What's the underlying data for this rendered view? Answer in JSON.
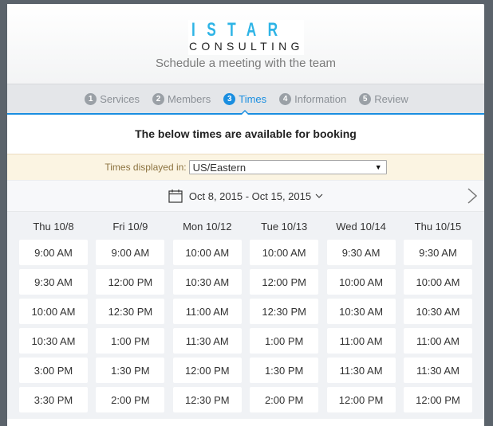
{
  "brand": {
    "logo_top": "ISTAR",
    "logo_bottom": "CONSULTING",
    "tagline": "Schedule a meeting with the team",
    "accent_color": "#2eb4e6"
  },
  "steps": [
    {
      "num": "1",
      "label": "Services",
      "active": false
    },
    {
      "num": "2",
      "label": "Members",
      "active": false
    },
    {
      "num": "3",
      "label": "Times",
      "active": true
    },
    {
      "num": "4",
      "label": "Information",
      "active": false
    },
    {
      "num": "5",
      "label": "Review",
      "active": false
    }
  ],
  "notice": "The below times are available for booking",
  "timezone": {
    "label": "Times displayed in:",
    "selected": "US/Eastern"
  },
  "date_range": {
    "label": "Oct 8, 2015 - Oct 15, 2015",
    "calendar_icon": "calendar-icon",
    "dropdown_icon": "chevron-down-icon",
    "next_icon": "chevron-right-icon"
  },
  "days": [
    {
      "label": "Thu 10/8",
      "slots": [
        "9:00 AM",
        "9:30 AM",
        "10:00 AM",
        "10:30 AM",
        "3:00 PM",
        "3:30 PM"
      ]
    },
    {
      "label": "Fri 10/9",
      "slots": [
        "9:00 AM",
        "12:00 PM",
        "12:30 PM",
        "1:00 PM",
        "1:30 PM",
        "2:00 PM"
      ]
    },
    {
      "label": "Mon 10/12",
      "slots": [
        "10:00 AM",
        "10:30 AM",
        "11:00 AM",
        "11:30 AM",
        "12:00 PM",
        "12:30 PM"
      ]
    },
    {
      "label": "Tue 10/13",
      "slots": [
        "10:00 AM",
        "12:00 PM",
        "12:30 PM",
        "1:00 PM",
        "1:30 PM",
        "2:00 PM"
      ]
    },
    {
      "label": "Wed 10/14",
      "slots": [
        "9:30 AM",
        "10:00 AM",
        "10:30 AM",
        "11:00 AM",
        "11:30 AM",
        "12:00 PM"
      ]
    },
    {
      "label": "Thu 10/15",
      "slots": [
        "9:30 AM",
        "10:00 AM",
        "10:30 AM",
        "11:00 AM",
        "11:30 AM",
        "12:00 PM"
      ]
    }
  ]
}
